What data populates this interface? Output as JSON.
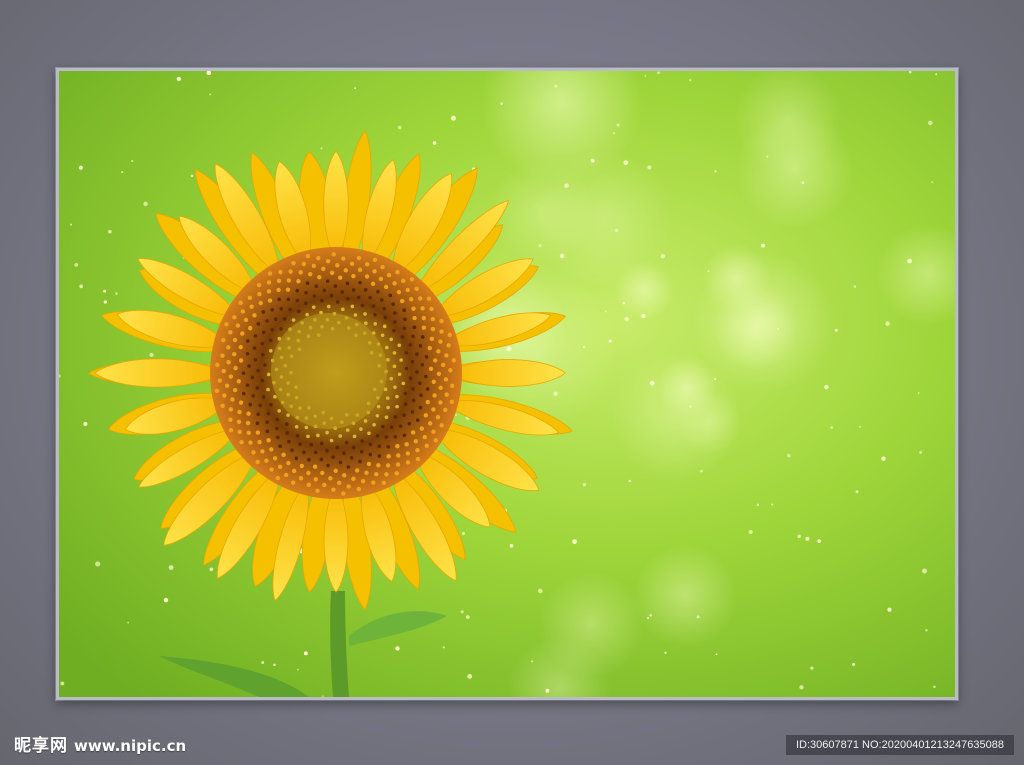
{
  "watermark": {
    "brand": "昵享网",
    "url": "www.nipic.cn",
    "id_text": "ID:30607871 NO:20200401213247635088"
  },
  "photo": {
    "subject": "sunflower",
    "colors": {
      "background_green": "#9fd63a",
      "petal_yellow": "#ffd21a",
      "center_brown": "#c9701a",
      "frame_gray": "#b9bcc4"
    }
  }
}
